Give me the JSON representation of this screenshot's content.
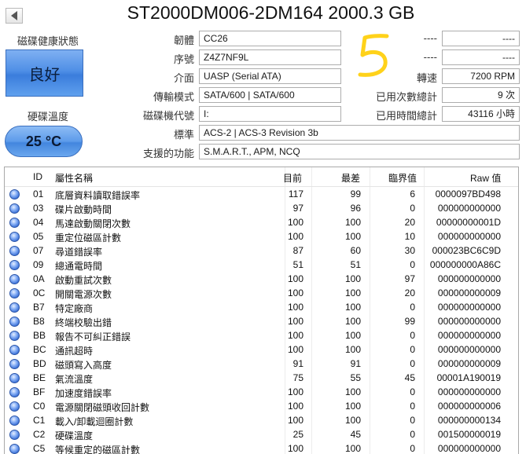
{
  "window": {
    "title": "ST2000DM006-2DM164 2000.3 GB"
  },
  "status": {
    "health_label": "磁碟健康狀態",
    "health_value": "良好",
    "temp_label": "硬碟溫度",
    "temp_value": "25 °C"
  },
  "info": {
    "firmware_label": "韌體",
    "firmware": "CC26",
    "serial_label": "序號",
    "serial": "Z4Z7NF9L",
    "interface_label": "介面",
    "interface": "UASP (Serial ATA)",
    "transfer_label": "傳輸模式",
    "transfer": "SATA/600 | SATA/600",
    "drive_letter_label": "磁碟機代號",
    "drive_letter": "I:",
    "standard_label": "標準",
    "standard": "ACS-2 | ACS-3 Revision 3b",
    "features_label": "支援的功能",
    "features": "S.M.A.R.T., APM, NCQ",
    "right_label1": "----",
    "right_value1": "----",
    "right_label2": "----",
    "right_value2": "----",
    "rotation_label": "轉速",
    "rotation": "7200 RPM",
    "power_count_label": "已用次數總計",
    "power_count": "9 次",
    "power_hours_label": "已用時間總計",
    "power_hours": "43116 小時"
  },
  "annotation": {
    "handwritten": "5"
  },
  "table": {
    "headers": {
      "id": "ID",
      "name": "屬性名稱",
      "current": "目前",
      "worst": "最差",
      "threshold": "臨界值",
      "raw": "Raw 值"
    },
    "rows": [
      {
        "id": "01",
        "name": "底層資料讀取錯誤率",
        "current": "117",
        "worst": "99",
        "threshold": "6",
        "raw": "0000097BD498"
      },
      {
        "id": "03",
        "name": "碟片啟動時間",
        "current": "97",
        "worst": "96",
        "threshold": "0",
        "raw": "000000000000"
      },
      {
        "id": "04",
        "name": "馬達啟動關閉次數",
        "current": "100",
        "worst": "100",
        "threshold": "20",
        "raw": "00000000001D"
      },
      {
        "id": "05",
        "name": "重定位磁區計數",
        "current": "100",
        "worst": "100",
        "threshold": "10",
        "raw": "000000000000"
      },
      {
        "id": "07",
        "name": "尋道錯誤率",
        "current": "87",
        "worst": "60",
        "threshold": "30",
        "raw": "000023BC6C9D"
      },
      {
        "id": "09",
        "name": "總通電時間",
        "current": "51",
        "worst": "51",
        "threshold": "0",
        "raw": "000000000A86C"
      },
      {
        "id": "0A",
        "name": "啟動重試次數",
        "current": "100",
        "worst": "100",
        "threshold": "97",
        "raw": "000000000000"
      },
      {
        "id": "0C",
        "name": "開關電源次數",
        "current": "100",
        "worst": "100",
        "threshold": "20",
        "raw": "000000000009"
      },
      {
        "id": "B7",
        "name": "特定廠商",
        "current": "100",
        "worst": "100",
        "threshold": "0",
        "raw": "000000000000"
      },
      {
        "id": "B8",
        "name": "終端校驗出錯",
        "current": "100",
        "worst": "100",
        "threshold": "99",
        "raw": "000000000000"
      },
      {
        "id": "BB",
        "name": "報告不可糾正錯誤",
        "current": "100",
        "worst": "100",
        "threshold": "0",
        "raw": "000000000000"
      },
      {
        "id": "BC",
        "name": "通訊超時",
        "current": "100",
        "worst": "100",
        "threshold": "0",
        "raw": "000000000000"
      },
      {
        "id": "BD",
        "name": "磁頭寫入高度",
        "current": "91",
        "worst": "91",
        "threshold": "0",
        "raw": "000000000009"
      },
      {
        "id": "BE",
        "name": "氣流溫度",
        "current": "75",
        "worst": "55",
        "threshold": "45",
        "raw": "00001A190019"
      },
      {
        "id": "BF",
        "name": "加速度錯誤率",
        "current": "100",
        "worst": "100",
        "threshold": "0",
        "raw": "000000000000"
      },
      {
        "id": "C0",
        "name": "電源關閉磁頭收回計數",
        "current": "100",
        "worst": "100",
        "threshold": "0",
        "raw": "000000000006"
      },
      {
        "id": "C1",
        "name": "載入/卸載迴圈計數",
        "current": "100",
        "worst": "100",
        "threshold": "0",
        "raw": "000000000134"
      },
      {
        "id": "C2",
        "name": "硬碟溫度",
        "current": "25",
        "worst": "45",
        "threshold": "0",
        "raw": "001500000019"
      },
      {
        "id": "C5",
        "name": "等候重定的磁區計數",
        "current": "100",
        "worst": "100",
        "threshold": "0",
        "raw": "000000000000"
      }
    ]
  }
}
